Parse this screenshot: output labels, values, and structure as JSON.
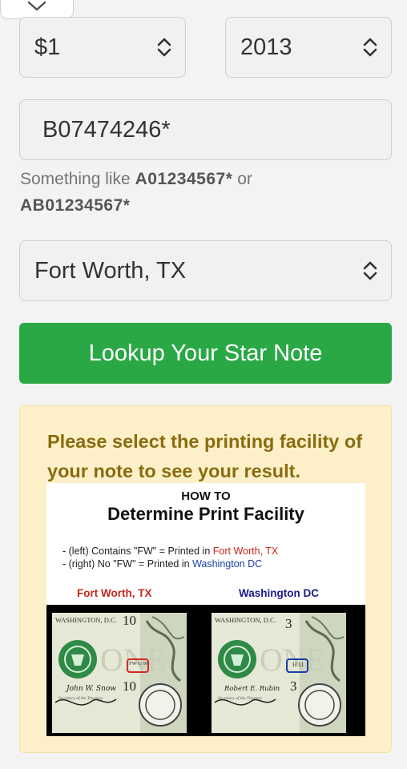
{
  "denomination": {
    "value": "$1"
  },
  "series": {
    "value": "2013"
  },
  "serial": {
    "value": "B07474246*"
  },
  "hint": {
    "prefix": "Something like",
    "example1": "A01234567*",
    "connector": "or",
    "example2": "AB01234567*"
  },
  "facility": {
    "value": "Fort Worth, TX"
  },
  "lookup_button": {
    "label": "Lookup Your Star Note"
  },
  "notice": {
    "message": "Please select the printing facility of your note to see your result."
  },
  "guide": {
    "how_to": "HOW TO",
    "title": "Determine Print Facility",
    "line1_prefix": "- (left) Contains \"FW\" = Printed in",
    "line1_place": "Fort Worth, TX",
    "line2_prefix": "- (right) No \"FW\" = Printed in",
    "line2_place": "Washington DC",
    "label_left": "Fort Worth, TX",
    "label_right": "Washington DC",
    "bill_left": {
      "city": "WASHINGTON, D.C.",
      "number": "10",
      "mark": "FW G 99",
      "signature": "John W. Snow",
      "caption": "Secretary of the Treasury"
    },
    "bill_right": {
      "city": "WASHINGTON, D.C.",
      "number": "3",
      "mark": "H 11",
      "signature": "Robert E. Rubin",
      "caption": "Secretary of the Treasury"
    }
  },
  "colors": {
    "primary": "#2aa846",
    "notice_bg": "#fdf0c8",
    "notice_text": "#8a6b10",
    "fw_red": "#c8261e",
    "dc_blue": "#1a3fa8"
  },
  "icons": {
    "collapse": "chevron-down-icon",
    "select": "updown-chevron-icon"
  }
}
